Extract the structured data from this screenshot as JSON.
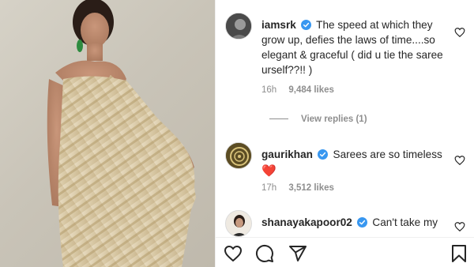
{
  "post": {
    "image_alt": ""
  },
  "comments": [
    {
      "username": "iamsrk",
      "verified": true,
      "text": "The speed at which they grow up, defies the laws of time....so elegant & graceful ( did u tie the saree urself??!! )",
      "time": "16h",
      "likes": "9,484 likes",
      "avatar_icon": "avatar-photo"
    },
    {
      "username": "gaurikhan",
      "verified": true,
      "text": "Sarees are so timeless",
      "emoji": "❤️",
      "time": "17h",
      "likes": "3,512 likes",
      "avatar_icon": "avatar-logo"
    },
    {
      "username": "shanayakapoor02",
      "verified": true,
      "text": "Can't take my",
      "avatar_icon": "avatar-photo"
    }
  ],
  "view_replies": "View replies (1)",
  "actions": {
    "like_icon": "heart-icon",
    "comment_icon": "comment-icon",
    "share_icon": "share-icon",
    "save_icon": "bookmark-icon"
  },
  "colors": {
    "verified": "#3897f0",
    "heart": "#ed4956",
    "meta": "#8e8e8e",
    "text": "#262626"
  }
}
